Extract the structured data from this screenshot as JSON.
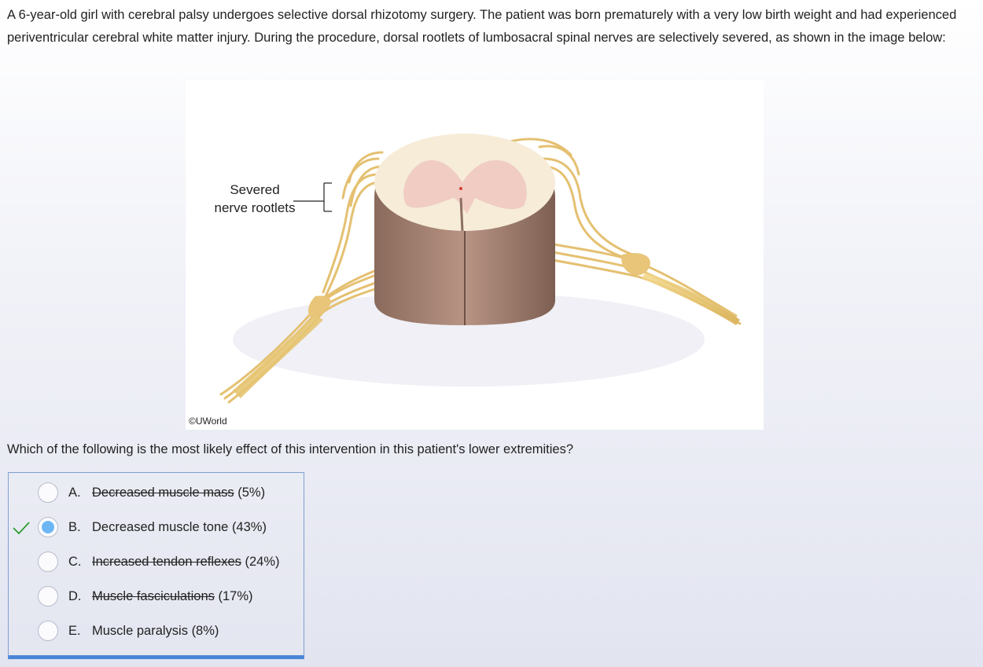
{
  "stem": "A 6-year-old girl with cerebral palsy undergoes selective dorsal rhizotomy surgery.  The patient was born prematurely with a very low birth weight and had experienced periventricular cerebral white matter injury.  During the procedure, dorsal rootlets of lumbosacral spinal nerves are selectively severed, as shown in the image below:",
  "figure": {
    "label_line1": "Severed",
    "label_line2": "nerve rootlets",
    "copyright": "©UWorld"
  },
  "question": "Which of the following is the most likely effect of this intervention in this patient's lower extremities?",
  "options": [
    {
      "letter": "A.",
      "text": "Decreased muscle mass",
      "percent": "(5%)",
      "struck": true,
      "selected": false,
      "correct": false
    },
    {
      "letter": "B.",
      "text": "Decreased muscle tone",
      "percent": "(43%)",
      "struck": false,
      "selected": true,
      "correct": true
    },
    {
      "letter": "C.",
      "text": "Increased tendon reflexes",
      "percent": "(24%)",
      "struck": true,
      "selected": false,
      "correct": false
    },
    {
      "letter": "D.",
      "text": "Muscle fasciculations",
      "percent": "(17%)",
      "struck": true,
      "selected": false,
      "correct": false
    },
    {
      "letter": "E.",
      "text": "Muscle paralysis",
      "percent": "(8%)",
      "struck": false,
      "selected": false,
      "correct": false
    }
  ],
  "colors": {
    "selected_radio": "#6cb7f3",
    "check_mark": "#2e9e2e",
    "answer_border": "#4a86d6"
  },
  "icons": {
    "correct": "check-icon"
  }
}
